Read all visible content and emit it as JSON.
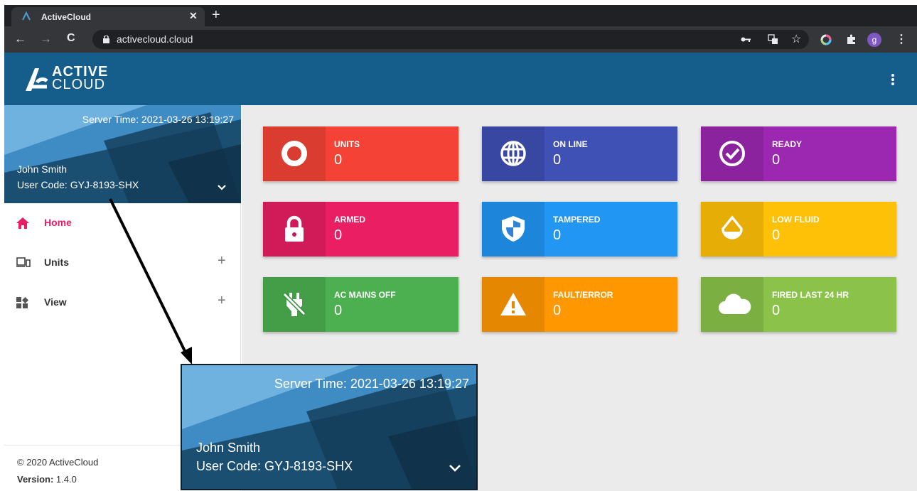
{
  "browser": {
    "tab_title": "ActiveCloud",
    "tab_close": "✕",
    "new_tab": "+",
    "url": "activecloud.cloud",
    "back": "←",
    "forward": "→",
    "reload": "C",
    "star": "☆",
    "profile_initial": "g",
    "menu": "⋮"
  },
  "header": {
    "logo_line1": "ACTIVE",
    "logo_line2": "CLOUD"
  },
  "profile": {
    "server_time": "Server Time: 2021-03-26 13:19:27",
    "name": "John Smith",
    "user_code": "User Code: GYJ-8193-SHX"
  },
  "sidebar": {
    "items": [
      {
        "label": "Home",
        "icon": "home-icon",
        "expandable": false
      },
      {
        "label": "Units",
        "icon": "devices-icon",
        "expandable": true,
        "toggle": "+"
      },
      {
        "label": "View",
        "icon": "dashboard-icon",
        "expandable": true,
        "toggle": "+"
      }
    ],
    "copyright": "© 2020 ActiveCloud",
    "version_label": "Version:",
    "version_value": "1.4.0"
  },
  "cards": [
    {
      "label": "UNITS",
      "value": "0",
      "color": "#f44336",
      "icon": "ring-icon"
    },
    {
      "label": "ON LINE",
      "value": "0",
      "color": "#3f51b5",
      "icon": "globe-icon"
    },
    {
      "label": "READY",
      "value": "0",
      "color": "#9c27b0",
      "icon": "check-circle-icon"
    },
    {
      "label": "ARMED",
      "value": "0",
      "color": "#e91e63",
      "icon": "lock-icon"
    },
    {
      "label": "TAMPERED",
      "value": "0",
      "color": "#2196f3",
      "icon": "shield-icon"
    },
    {
      "label": "LOW FLUID",
      "value": "0",
      "color": "#ffc107",
      "icon": "drop-icon"
    },
    {
      "label": "AC MAINS OFF",
      "value": "0",
      "color": "#4caf50",
      "icon": "power-off-icon"
    },
    {
      "label": "FAULT/ERROR",
      "value": "0",
      "color": "#ff9800",
      "icon": "warning-icon"
    },
    {
      "label": "FIRED LAST 24 HR",
      "value": "0",
      "color": "#8bc34a",
      "icon": "cloud-icon"
    }
  ]
}
